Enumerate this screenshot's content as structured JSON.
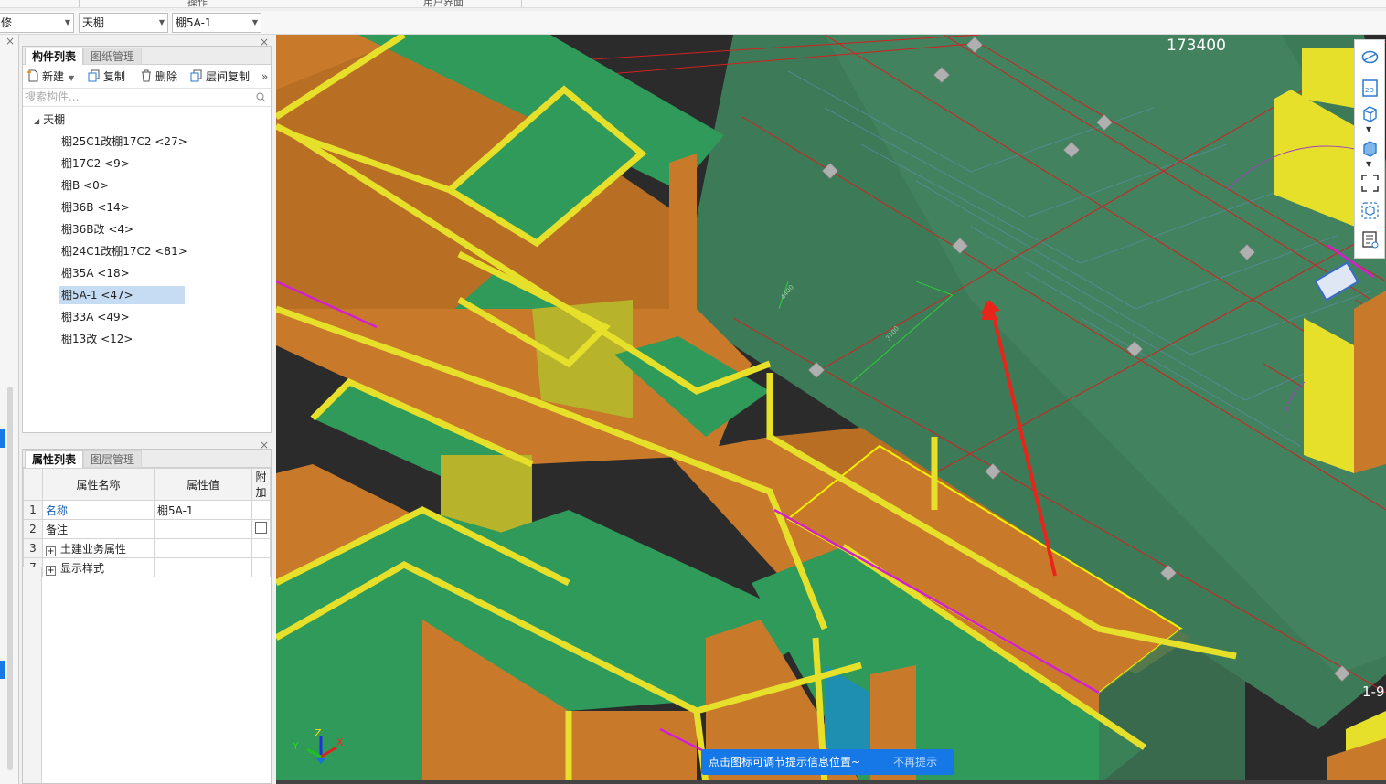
{
  "top_strip": {
    "left_label": "操作",
    "right_label": "用户界面"
  },
  "selectors": {
    "floor_partial": "修",
    "type": "天棚",
    "component": "棚5A-1"
  },
  "component_panel": {
    "tabs": [
      "构件列表",
      "图纸管理"
    ],
    "toolbar": {
      "new": "新建",
      "copy": "复制",
      "delete": "删除",
      "floor_copy": "层间复制"
    },
    "search_placeholder": "搜索构件...",
    "tree_root": "天棚",
    "items": [
      "棚25C1改棚17C2 <27>",
      "棚17C2 <9>",
      "棚B <0>",
      "棚36B <14>",
      "棚36B改 <4>",
      "棚24C1改棚17C2 <81>",
      "棚35A <18>",
      "棚5A-1 <47>",
      "棚33A <49>",
      "棚13改 <12>"
    ],
    "selected_index": 7
  },
  "property_panel": {
    "tabs": [
      "属性列表",
      "图层管理"
    ],
    "headers": [
      "属性名称",
      "属性值",
      "附加"
    ],
    "rows": [
      {
        "num": "1",
        "name": "名称",
        "value": "棚5A-1"
      },
      {
        "num": "2",
        "name": "备注",
        "value": ""
      },
      {
        "num": "3",
        "name": "土建业务属性",
        "value": ""
      },
      {
        "num": "7",
        "name": "显示样式",
        "value": ""
      }
    ]
  },
  "viewport": {
    "coordinate": "173400",
    "edge_label": "1-9",
    "hint_message": "点击图标可调节提示信息位置~",
    "hint_dismiss": "不再提示",
    "dim_labels": [
      "4400",
      "3700"
    ],
    "axis_labels": {
      "x": "X",
      "y": "Y",
      "z": "Z"
    }
  },
  "colors": {
    "wall_orange": "#c87a2a",
    "ceiling_green": "#2f9a5a",
    "beam_yellow": "#e6e02a",
    "grid_red": "#d42020",
    "hint_blue": "#1677e6",
    "selection_blue": "#c5dcf2"
  },
  "icons": [
    "new-icon",
    "copy-icon",
    "delete-icon",
    "floor-copy-icon",
    "orbit-icon",
    "2d-icon",
    "3d-box-icon",
    "solid-box-icon",
    "fullscreen-icon",
    "view-cube-icon",
    "layer-list-icon"
  ]
}
